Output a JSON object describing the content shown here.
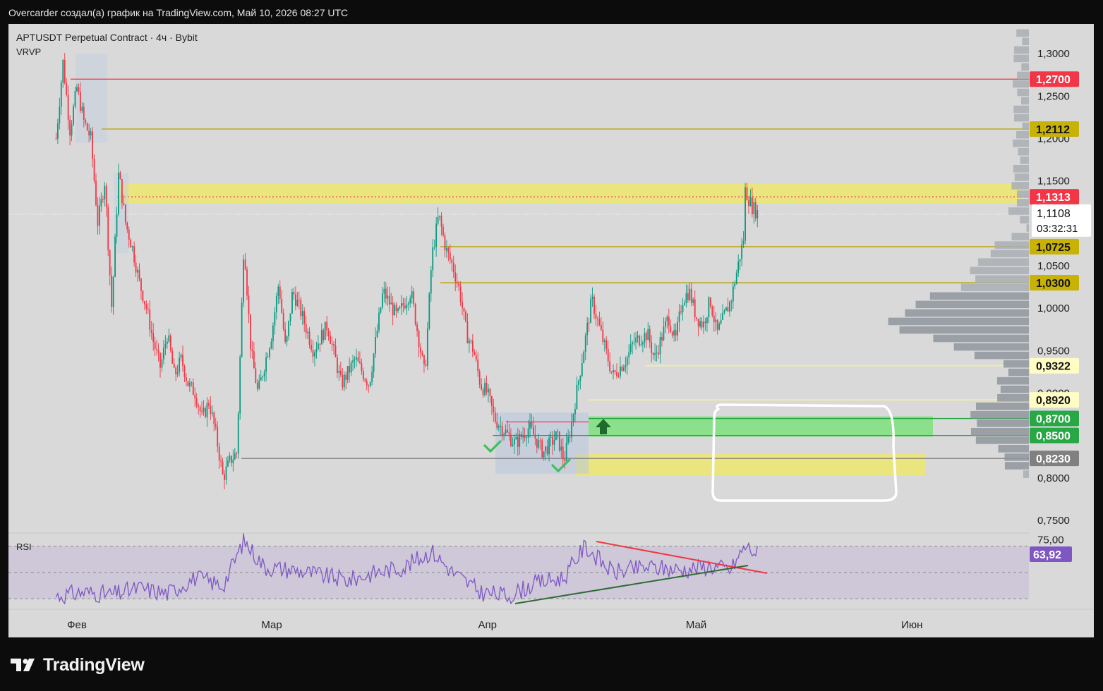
{
  "header": {
    "caption": "Overcarder создал(а) график на TradingView.com, Май 10, 2026 08:27 UTC"
  },
  "legend": {
    "symbol_line": "APTUSDT Perpetual Contract · 4ч · Bybit",
    "indicator": "VRVP"
  },
  "rsi_panel": {
    "label": "RSI",
    "current_value": "63,92",
    "upper_band_label": "75,00",
    "upper_band": 70,
    "lower_band": 30,
    "middle_band": 50
  },
  "price_axis": {
    "ticks": [
      "1,3000",
      "1,2500",
      "1,2000",
      "1,1500",
      "1,1000",
      "1,0500",
      "1,0000",
      "0,9500",
      "0,9000",
      "0,8500",
      "0,8000",
      "0,7500"
    ],
    "range": [
      0.735,
      1.335
    ]
  },
  "price_labels": [
    {
      "text": "1,2700",
      "price": 1.27,
      "bg": "#f23645",
      "fg": "#ffffff"
    },
    {
      "text": "1,2112",
      "price": 1.2112,
      "bg": "#c9b206",
      "fg": "#111111"
    },
    {
      "text": "1,1313",
      "price": 1.1313,
      "bg": "#f23645",
      "fg": "#ffffff"
    },
    {
      "text": "1,0725",
      "price": 1.0725,
      "bg": "#c9b206",
      "fg": "#111111"
    },
    {
      "text": "1,0300",
      "price": 1.03,
      "bg": "#c9b206",
      "fg": "#111111"
    },
    {
      "text": "0,9322",
      "price": 0.9322,
      "bg": "#fffdc4",
      "fg": "#111111"
    },
    {
      "text": "0,8920",
      "price": 0.892,
      "bg": "#fffdc4",
      "fg": "#111111"
    },
    {
      "text": "0,8700",
      "price": 0.87,
      "bg": "#28a745",
      "fg": "#ffffff"
    },
    {
      "text": "0,8500",
      "price": 0.85,
      "bg": "#28a745",
      "fg": "#ffffff"
    },
    {
      "text": "0,8230",
      "price": 0.823,
      "bg": "#808080",
      "fg": "#ffffff"
    }
  ],
  "current_price": {
    "text": "1,1108",
    "countdown": "03:32:31",
    "price": 1.1108
  },
  "time_axis": {
    "labels": [
      "Фев",
      "Мар",
      "Апр",
      "Май",
      "Июн"
    ]
  },
  "brand": {
    "name": "TradingView"
  },
  "colors": {
    "up": "#089981",
    "down": "#f23645",
    "rsi_line": "#7e57c2",
    "resistance_zone": "#f2ea5a",
    "support_zone": "#7ee07e"
  },
  "chart_data": [
    {
      "type": "candlestick",
      "title": "APTUSDT Perpetual Contract · 4ч · Bybit",
      "timeframe": "4ч",
      "x_range": [
        "Фев",
        "Июн"
      ],
      "ylim": [
        0.735,
        1.335
      ],
      "path": [
        [
          "2026-01-29",
          1.34
        ],
        [
          "2026-01-29",
          1.2
        ],
        [
          "2026-01-30",
          1.29
        ],
        [
          "2026-01-31",
          1.21
        ],
        [
          "2026-02-01",
          1.26
        ],
        [
          "2026-02-02",
          1.22
        ],
        [
          "2026-02-03",
          1.2
        ],
        [
          "2026-02-04",
          1.1
        ],
        [
          "2026-02-05",
          1.15
        ],
        [
          "2026-02-06",
          1.0
        ],
        [
          "2026-02-07",
          1.16
        ],
        [
          "2026-02-08",
          1.1
        ],
        [
          "2026-02-09",
          1.07
        ],
        [
          "2026-02-10",
          1.03
        ],
        [
          "2026-02-11",
          1.0
        ],
        [
          "2026-02-12",
          0.96
        ],
        [
          "2026-02-13",
          0.93
        ],
        [
          "2026-02-14",
          0.97
        ],
        [
          "2026-02-15",
          0.92
        ],
        [
          "2026-02-16",
          0.94
        ],
        [
          "2026-02-17",
          0.91
        ],
        [
          "2026-02-18",
          0.9
        ],
        [
          "2026-02-19",
          0.87
        ],
        [
          "2026-02-20",
          0.89
        ],
        [
          "2026-02-21",
          0.85
        ],
        [
          "2026-02-22",
          0.8
        ],
        [
          "2026-02-23",
          0.82
        ],
        [
          "2026-02-24",
          0.83
        ],
        [
          "2026-02-25",
          1.08
        ],
        [
          "2026-02-26",
          0.95
        ],
        [
          "2026-02-27",
          0.9
        ],
        [
          "2026-03-01",
          0.97
        ],
        [
          "2026-03-02",
          1.03
        ],
        [
          "2026-03-03",
          0.95
        ],
        [
          "2026-03-04",
          1.02
        ],
        [
          "2026-03-05",
          1.0
        ],
        [
          "2026-03-07",
          0.95
        ],
        [
          "2026-03-09",
          0.98
        ],
        [
          "2026-03-11",
          0.91
        ],
        [
          "2026-03-13",
          0.94
        ],
        [
          "2026-03-15",
          0.91
        ],
        [
          "2026-03-17",
          1.02
        ],
        [
          "2026-03-19",
          0.99
        ],
        [
          "2026-03-21",
          1.02
        ],
        [
          "2026-03-23",
          0.92
        ],
        [
          "2026-03-24",
          1.06
        ],
        [
          "2026-03-25",
          1.11
        ],
        [
          "2026-03-26",
          1.07
        ],
        [
          "2026-03-27",
          1.05
        ],
        [
          "2026-03-28",
          1.02
        ],
        [
          "2026-03-29",
          0.97
        ],
        [
          "2026-03-30",
          0.95
        ],
        [
          "2026-03-31",
          0.91
        ],
        [
          "2026-04-01",
          0.9
        ],
        [
          "2026-04-02",
          0.87
        ],
        [
          "2026-04-03",
          0.86
        ],
        [
          "2026-04-05",
          0.84
        ],
        [
          "2026-04-07",
          0.86
        ],
        [
          "2026-04-09",
          0.83
        ],
        [
          "2026-04-11",
          0.85
        ],
        [
          "2026-04-12",
          0.82
        ],
        [
          "2026-04-13",
          0.86
        ],
        [
          "2026-04-14",
          0.91
        ],
        [
          "2026-04-15",
          0.96
        ],
        [
          "2026-04-16",
          1.01
        ],
        [
          "2026-04-17",
          0.98
        ],
        [
          "2026-04-18",
          0.95
        ],
        [
          "2026-04-19",
          0.92
        ],
        [
          "2026-04-21",
          0.94
        ],
        [
          "2026-04-22",
          0.96
        ],
        [
          "2026-04-24",
          0.97
        ],
        [
          "2026-04-25",
          0.94
        ],
        [
          "2026-04-27",
          0.99
        ],
        [
          "2026-04-28",
          0.96
        ],
        [
          "2026-04-29",
          1.01
        ],
        [
          "2026-04-30",
          1.02
        ],
        [
          "2026-05-01",
          0.99
        ],
        [
          "2026-05-02",
          0.98
        ],
        [
          "2026-05-03",
          1.01
        ],
        [
          "2026-05-04",
          0.97
        ],
        [
          "2026-05-05",
          0.99
        ],
        [
          "2026-05-06",
          1.01
        ],
        [
          "2026-05-07",
          1.05
        ],
        [
          "2026-05-08",
          1.09
        ],
        [
          "2026-05-08",
          1.14
        ],
        [
          "2026-05-09",
          1.12
        ],
        [
          "2026-05-10",
          1.1108
        ]
      ]
    },
    {
      "type": "line",
      "title": "RSI",
      "ylim": [
        22,
        80
      ],
      "current": 63.92,
      "path": [
        [
          "2026-01-29",
          32
        ],
        [
          "2026-02-02",
          35
        ],
        [
          "2026-02-06",
          33
        ],
        [
          "2026-02-10",
          38
        ],
        [
          "2026-02-14",
          34
        ],
        [
          "2026-02-18",
          46
        ],
        [
          "2026-02-22",
          40
        ],
        [
          "2026-02-25",
          74
        ],
        [
          "2026-02-28",
          54
        ],
        [
          "2026-03-04",
          52
        ],
        [
          "2026-03-08",
          48
        ],
        [
          "2026-03-12",
          44
        ],
        [
          "2026-03-16",
          50
        ],
        [
          "2026-03-20",
          54
        ],
        [
          "2026-03-24",
          66
        ],
        [
          "2026-03-27",
          50
        ],
        [
          "2026-03-31",
          35
        ],
        [
          "2026-04-04",
          32
        ],
        [
          "2026-04-08",
          42
        ],
        [
          "2026-04-12",
          46
        ],
        [
          "2026-04-15",
          70
        ],
        [
          "2026-04-19",
          50
        ],
        [
          "2026-04-24",
          54
        ],
        [
          "2026-04-29",
          52
        ],
        [
          "2026-05-03",
          55
        ],
        [
          "2026-05-06",
          52
        ],
        [
          "2026-05-08",
          70
        ],
        [
          "2026-05-10",
          63.92
        ]
      ]
    }
  ]
}
